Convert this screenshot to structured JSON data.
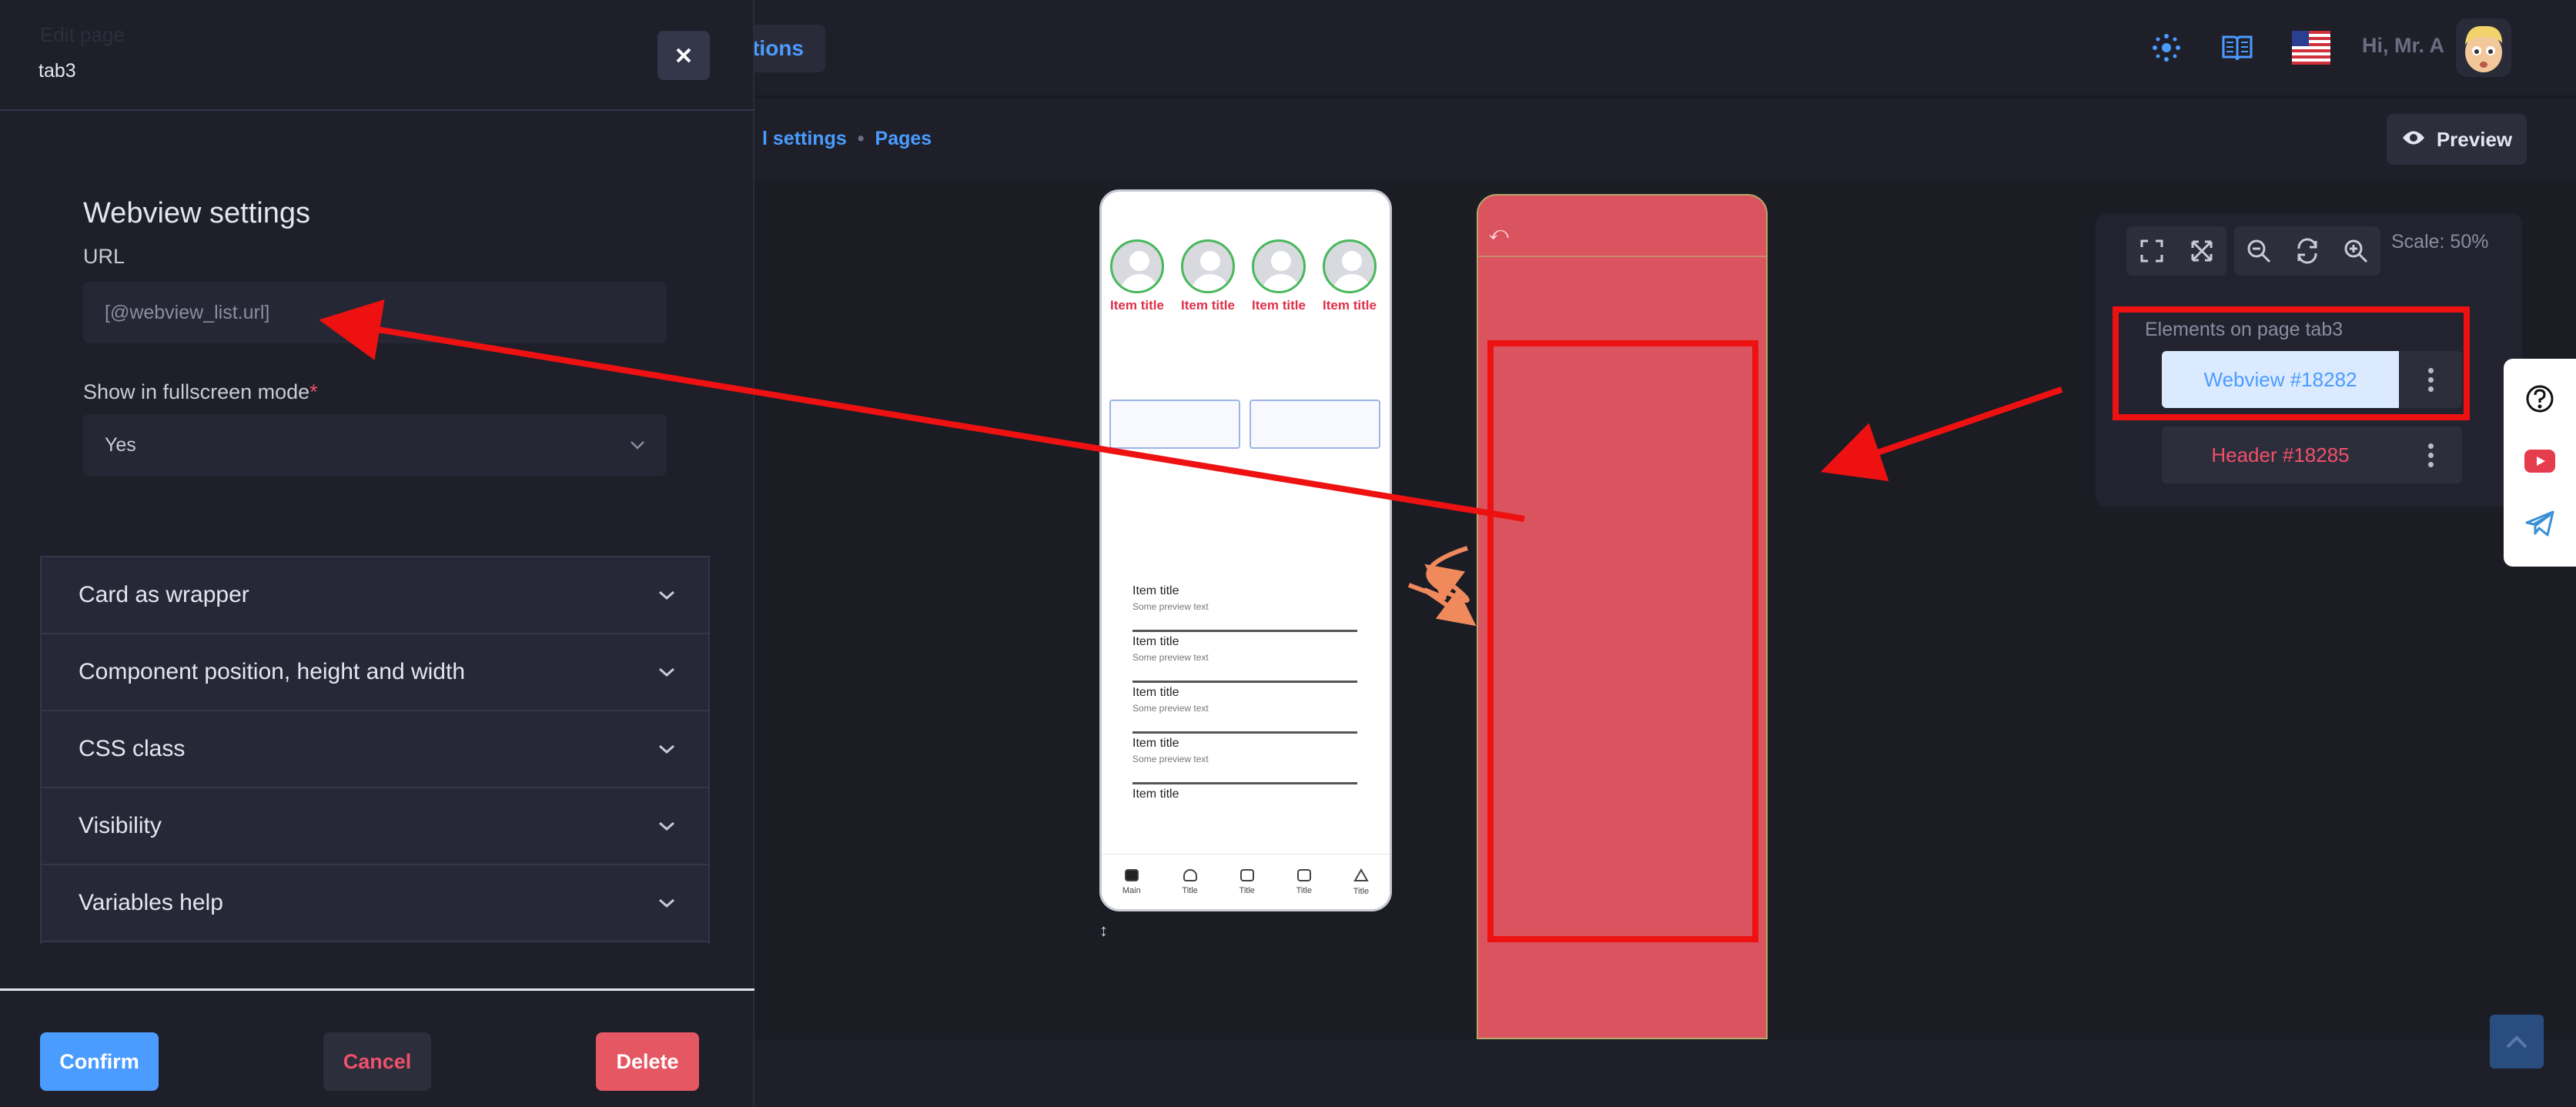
{
  "topbar": {
    "nav_pill": "tions",
    "greeting": "Hi, Mr. A",
    "icons": [
      "settings-spinner-icon",
      "book-icon",
      "us-flag-icon"
    ]
  },
  "subbar": {
    "breadcrumb": [
      "l settings",
      "•",
      "Pages"
    ],
    "preview_label": "Preview"
  },
  "drawer": {
    "faded_title": "Edit page",
    "subtitle": "tab3",
    "section_title": "Webview settings",
    "url_label": "URL",
    "url_value": "[@webview_list.url]",
    "fullscreen_label": "Show in fullscreen mode",
    "required_mark": "*",
    "fullscreen_value": "Yes",
    "accordion": [
      "Card as wrapper",
      "Component position, height and width",
      "CSS class",
      "Visibility",
      "Variables help"
    ],
    "buttons": {
      "confirm": "Confirm",
      "cancel": "Cancel",
      "delete": "Delete"
    }
  },
  "phone": {
    "stories": [
      "Item title",
      "Item title",
      "Item title",
      "Item title"
    ],
    "list": [
      {
        "title": "Item title",
        "subtitle": "Some preview text"
      },
      {
        "title": "Item title",
        "subtitle": "Some preview text"
      },
      {
        "title": "Item title",
        "subtitle": "Some preview text"
      },
      {
        "title": "Item title",
        "subtitle": "Some preview text"
      },
      {
        "title": "Item title",
        "subtitle": ""
      }
    ],
    "tabs": [
      "Main",
      "Title",
      "Title",
      "Title",
      "Title"
    ],
    "resize_mark": "↕"
  },
  "redpage": {
    "back_symbol": "⤺"
  },
  "elements_panel": {
    "scale": "Scale: 50%",
    "title": "Elements on page tab3",
    "items": [
      "Webview #18282",
      "Header #18285"
    ]
  },
  "colors": {
    "accent": "#4b9cff",
    "danger": "#f0506a",
    "annotation": "#ee1111",
    "page_preview": "#d9545e",
    "arrow_orange": "#f08a5d"
  }
}
